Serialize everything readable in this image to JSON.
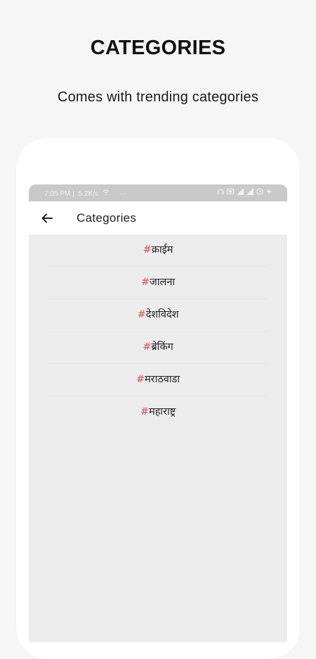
{
  "promo": {
    "title": "CATEGORIES",
    "subtitle": "Comes with trending categories"
  },
  "status_bar": {
    "time": "7:05 PM",
    "speed": "5.2K/s",
    "more": "···",
    "icons": [
      "headphones-icon",
      "vo-lte-icon",
      "signal-icon",
      "signal-icon",
      "clock-icon",
      "charging-icon"
    ]
  },
  "app_bar": {
    "back_icon": "arrow-left-icon",
    "title": "Categories"
  },
  "categories": [
    {
      "hash": "#",
      "label": "क्राईम"
    },
    {
      "hash": "#",
      "label": "जालना"
    },
    {
      "hash": "#",
      "label": "देशविदेश"
    },
    {
      "hash": "#",
      "label": "ब्रेकिंग"
    },
    {
      "hash": "#",
      "label": "मराठवाडा"
    },
    {
      "hash": "#",
      "label": "महाराष्ट्र"
    }
  ],
  "colors": {
    "hash_accent": "#e24a5e",
    "screen_bg": "#ededed",
    "status_bar_bg": "#c9c9c9"
  }
}
